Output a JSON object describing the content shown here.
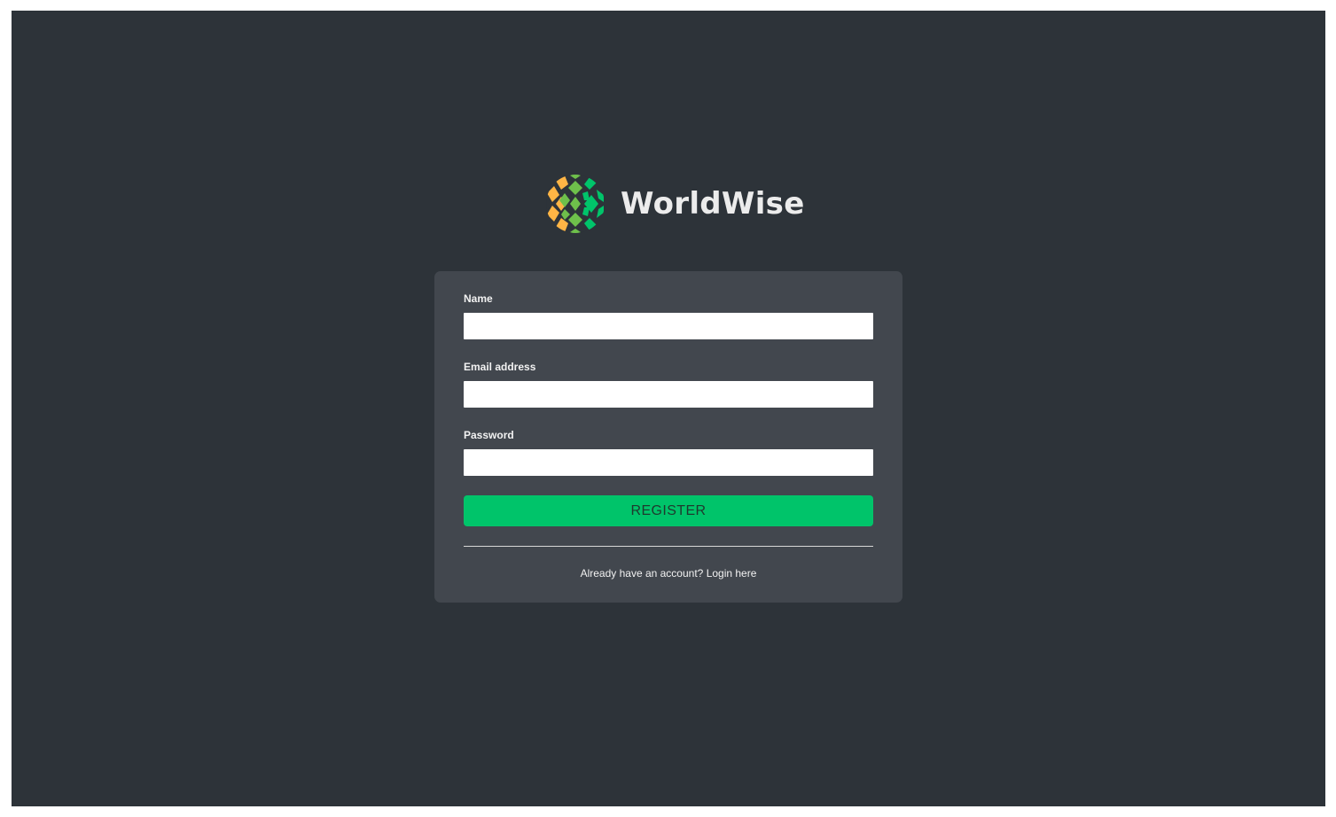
{
  "brand": {
    "name": "WorldWise",
    "logo_icon": "globe-mosaic-icon",
    "colors": {
      "green": "#00c46a",
      "light_green": "#6ec04b",
      "orange": "#ffb545"
    }
  },
  "form": {
    "name_label": "Name",
    "name_value": "",
    "email_label": "Email address",
    "email_value": "",
    "password_label": "Password",
    "password_value": "",
    "submit_label": "REGISTER"
  },
  "footer": {
    "prompt_text": "Already have an account?",
    "login_link": "Login here"
  },
  "theme": {
    "background": "#2d3339",
    "card": "#42474e",
    "button": "#00c46a"
  }
}
